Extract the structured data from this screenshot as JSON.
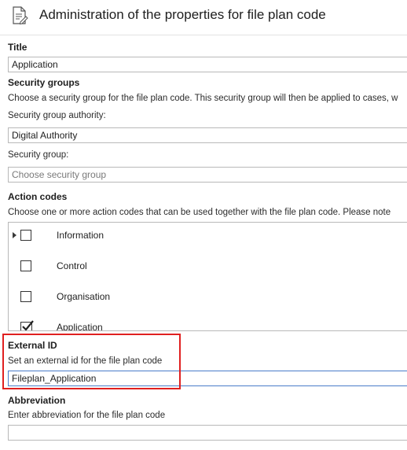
{
  "header": {
    "title": "Administration of the properties for file plan code",
    "icon": "document-edit-icon"
  },
  "title_section": {
    "label": "Title",
    "value": "Application"
  },
  "security_groups": {
    "label": "Security groups",
    "help": "Choose a security group for the file plan code. This security group will then be applied to cases, w",
    "authority_label": "Security group authority:",
    "authority_value": "Digital Authority",
    "group_label": "Security group:",
    "group_placeholder": "Choose security group"
  },
  "action_codes": {
    "label": "Action codes",
    "help": "Choose one or more action codes that can be used together with the file plan code. Please note",
    "items": [
      {
        "label": "Information",
        "checked": false,
        "current": true
      },
      {
        "label": "Control",
        "checked": false,
        "current": false
      },
      {
        "label": "Organisation",
        "checked": false,
        "current": false
      },
      {
        "label": "Application",
        "checked": true,
        "current": false
      }
    ]
  },
  "external_id": {
    "label": "External ID",
    "help": "Set an external id for the file plan code",
    "value": "Fileplan_Application",
    "highlight_color": "#e02020"
  },
  "abbreviation": {
    "label": "Abbreviation",
    "help": "Enter abbreviation for the file plan code",
    "value": ""
  }
}
